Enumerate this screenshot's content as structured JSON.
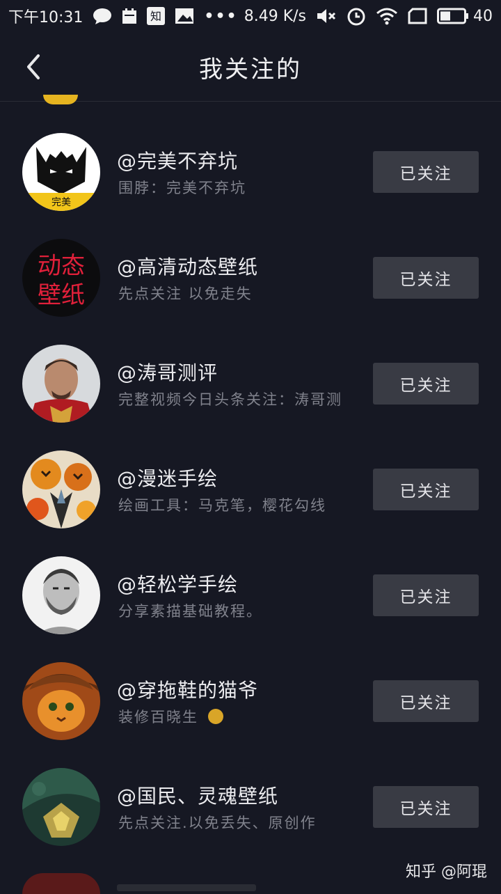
{
  "status_bar": {
    "time": "下午10:31",
    "speed": "8.49 K/s",
    "battery": "40"
  },
  "header": {
    "title": "我关注的"
  },
  "follows": [
    {
      "name": "@完美不弃坑",
      "bio": "围脖：完美不弃坑",
      "button": "已关注"
    },
    {
      "name": "@高清动态壁纸",
      "bio": "先点关注 以免走失",
      "button": "已关注"
    },
    {
      "name": "@涛哥测评",
      "bio": "完整视频今日头条关注：涛哥测",
      "button": "已关注"
    },
    {
      "name": "@漫迷手绘",
      "bio": "绘画工具：马克笔，樱花勾线",
      "button": "已关注"
    },
    {
      "name": "@轻松学手绘",
      "bio": "分享素描基础教程。",
      "button": "已关注"
    },
    {
      "name": "@穿拖鞋的猫爷",
      "bio": "装修百晓生",
      "button": "已关注"
    },
    {
      "name": "@国民、灵魂壁纸",
      "bio": "先点关注.以免丢失、原创作",
      "button": "已关注"
    }
  ],
  "avatars": {
    "wall_text_1": "动态",
    "wall_text_2": "壁纸"
  },
  "watermark": "知乎 @阿琨",
  "colors": {
    "background": "#161823",
    "button_bg": "#393b44",
    "bio_text": "#80828c"
  }
}
